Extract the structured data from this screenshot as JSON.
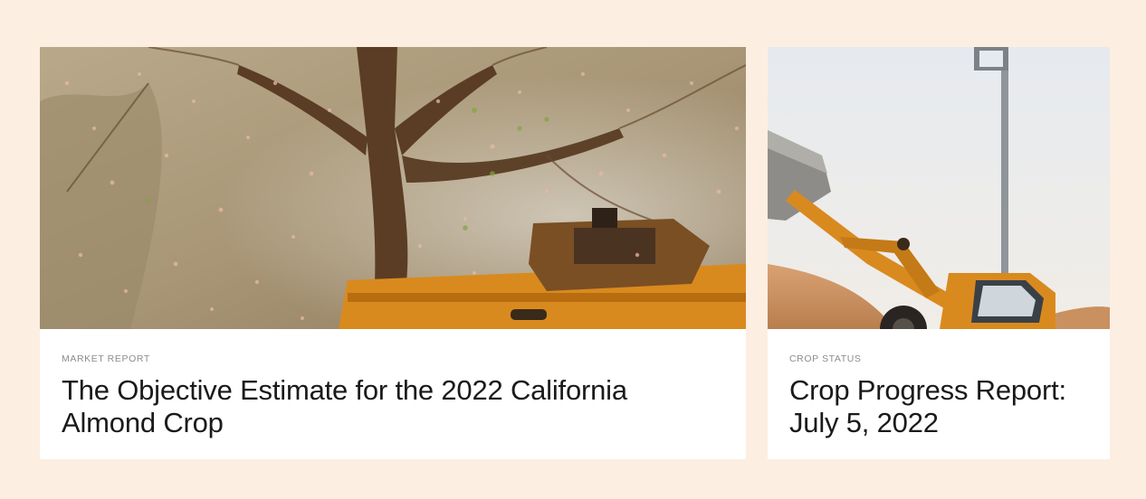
{
  "cards": [
    {
      "category": "MARKET REPORT",
      "title": "The Objective Estimate for the 2022 California Almond Crop",
      "image": "almond-tree-shaker-photo"
    },
    {
      "category": "CROP STATUS",
      "title": "Crop Progress Report: July 5, 2022",
      "image": "loader-bucket-almond-pile-photo"
    }
  ],
  "colors": {
    "page_background": "#fdeee2",
    "card_background": "#ffffff",
    "category_text": "#8c8c8c",
    "title_text": "#1a1a1a",
    "machinery_orange": "#d98a1e"
  }
}
